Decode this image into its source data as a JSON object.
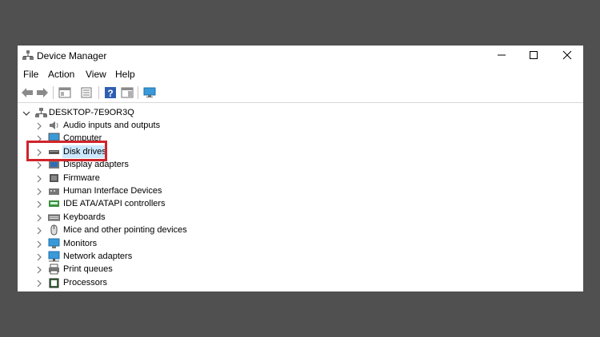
{
  "window": {
    "title": "Device Manager"
  },
  "menu": {
    "file": "File",
    "action": "Action",
    "view": "View",
    "help": "Help"
  },
  "tree": {
    "root": "DESKTOP-7E9OR3Q",
    "items": [
      {
        "label": "Audio inputs and outputs",
        "icon": "speaker-icon"
      },
      {
        "label": "Computer",
        "icon": "computer-icon"
      },
      {
        "label": "Disk drives",
        "icon": "disk-drive-icon",
        "selected": true
      },
      {
        "label": "Display adapters",
        "icon": "display-adapter-icon"
      },
      {
        "label": "Firmware",
        "icon": "firmware-icon"
      },
      {
        "label": "Human Interface Devices",
        "icon": "hid-icon"
      },
      {
        "label": "IDE ATA/ATAPI controllers",
        "icon": "ide-controller-icon"
      },
      {
        "label": "Keyboards",
        "icon": "keyboard-icon"
      },
      {
        "label": "Mice and other pointing devices",
        "icon": "mouse-icon"
      },
      {
        "label": "Monitors",
        "icon": "monitor-icon"
      },
      {
        "label": "Network adapters",
        "icon": "network-adapter-icon"
      },
      {
        "label": "Print queues",
        "icon": "printer-icon"
      },
      {
        "label": "Processors",
        "icon": "processor-icon"
      }
    ]
  },
  "colors": {
    "background": "#505050",
    "highlight_border": "#d0242b",
    "selection": "#cce8ff"
  }
}
